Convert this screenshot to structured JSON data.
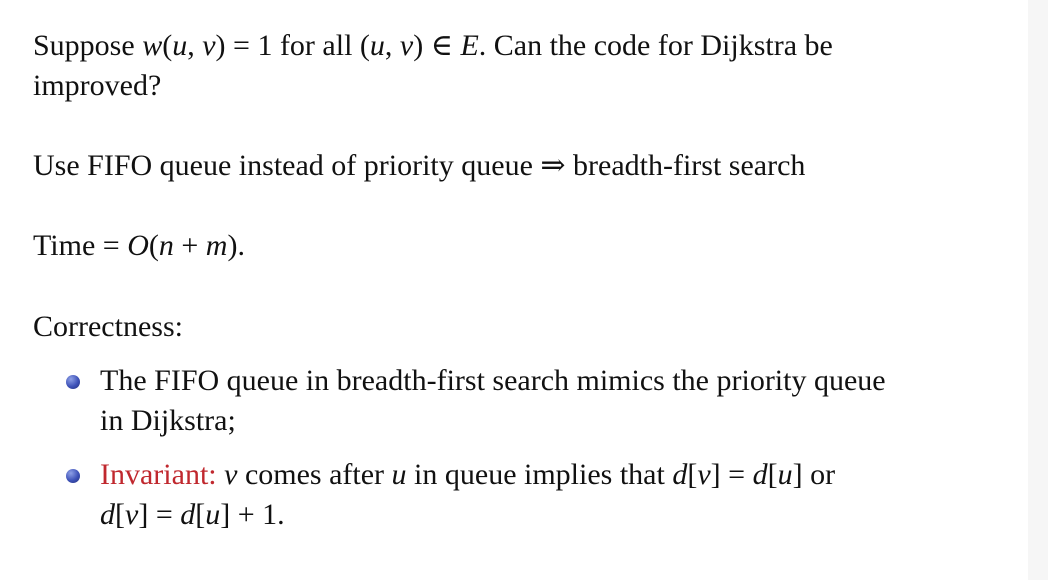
{
  "p1": {
    "a": "Suppose ",
    "b": "w",
    "c": "(",
    "d": "u",
    "e": ", ",
    "f": "v",
    "g": ") = 1 for all (",
    "h": "u",
    "i": ", ",
    "j": "v",
    "k": ") ∈ ",
    "l": "E",
    "m": ". Can the code for Dijkstra be",
    "line2": "improved?"
  },
  "p2": {
    "text": "Use FIFO queue instead of priority queue ⇒ breadth-first search"
  },
  "p3": {
    "a": "Time = ",
    "b": "O",
    "c": "(",
    "d": "n",
    "e": " + ",
    "f": "m",
    "g": ")."
  },
  "p4": {
    "text": "Correctness:"
  },
  "bullets": {
    "b1_line1": "The FIFO queue in breadth-first search mimics the priority queue",
    "b1_line2": "in Dijkstra;",
    "b2": {
      "label": "Invariant:",
      "s1": " ",
      "v1": "v",
      "s2": " comes after ",
      "u1": "u",
      "s3": " in queue implies that ",
      "d1": "d",
      "s4": "[",
      "v2": "v",
      "s5": "] = ",
      "d2": "d",
      "s6": "[",
      "u2": "u",
      "s7": "] or",
      "l2_d1": "d",
      "l2_s1": "[",
      "l2_v": "v",
      "l2_s2": "] = ",
      "l2_d2": "d",
      "l2_s3": "[",
      "l2_u": "u",
      "l2_s4": "] + 1."
    }
  },
  "colors": {
    "bullet": "#3e52b8",
    "invariant": "#c0282e",
    "text": "#111111"
  }
}
